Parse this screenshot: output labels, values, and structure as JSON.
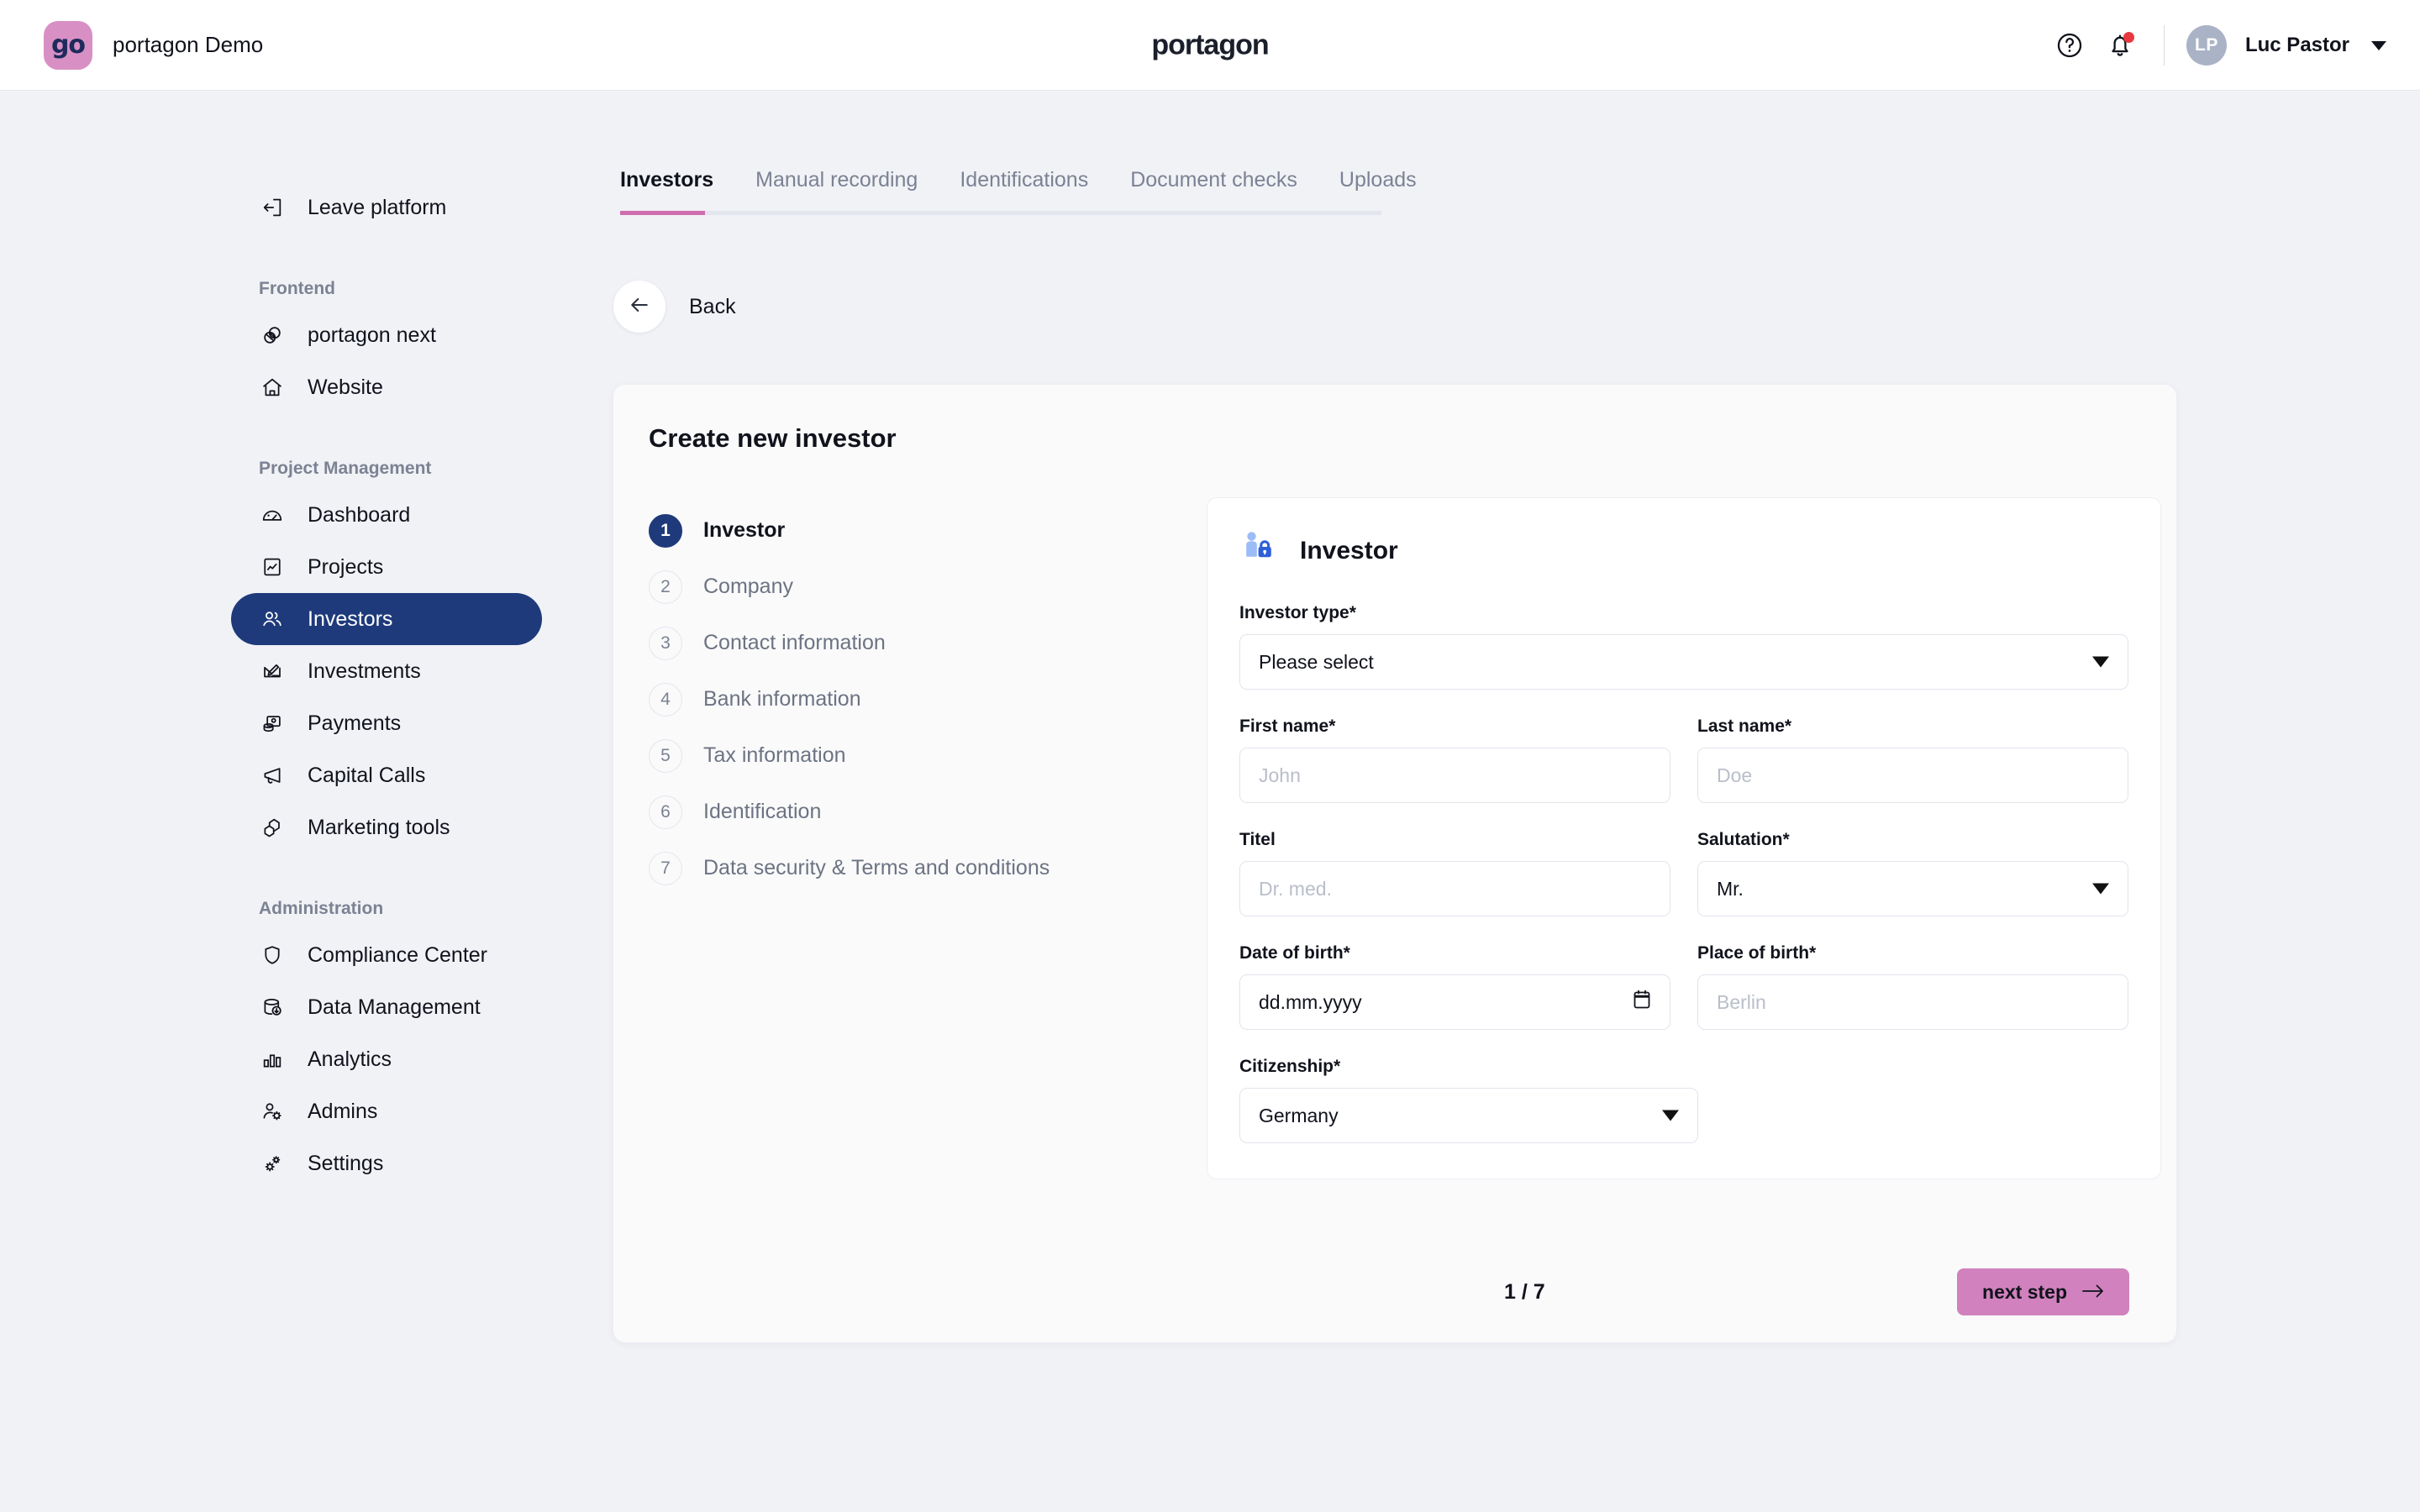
{
  "header": {
    "org_badge": "go",
    "org_name": "portagon Demo",
    "product_logo": "portagon",
    "help_icon": "help-circle-icon",
    "notifications_icon": "bell-icon",
    "avatar_initials": "LP",
    "user_name": "Luc Pastor",
    "user_menu_icon": "chevron-down-icon"
  },
  "sidebar": {
    "leave": {
      "label": "Leave platform",
      "icon": "logout-icon"
    },
    "groups": [
      {
        "title": "Frontend",
        "items": [
          {
            "label": "portagon next",
            "icon": "layers-icon",
            "active": false
          },
          {
            "label": "Website",
            "icon": "home-icon",
            "active": false
          }
        ]
      },
      {
        "title": "Project Management",
        "items": [
          {
            "label": "Dashboard",
            "icon": "gauge-icon",
            "active": false
          },
          {
            "label": "Projects",
            "icon": "chart-document-icon",
            "active": false
          },
          {
            "label": "Investors",
            "icon": "users-icon",
            "active": true
          },
          {
            "label": "Investments",
            "icon": "signature-icon",
            "active": false
          },
          {
            "label": "Payments",
            "icon": "coins-icon",
            "active": false
          },
          {
            "label": "Capital Calls",
            "icon": "megaphone-icon",
            "active": false
          },
          {
            "label": "Marketing tools",
            "icon": "boxes-icon",
            "active": false
          }
        ]
      },
      {
        "title": "Administration",
        "items": [
          {
            "label": "Compliance Center",
            "icon": "shield-icon",
            "active": false
          },
          {
            "label": "Data Management",
            "icon": "database-download-icon",
            "active": false
          },
          {
            "label": "Analytics",
            "icon": "bar-chart-icon",
            "active": false
          },
          {
            "label": "Admins",
            "icon": "user-gear-icon",
            "active": false
          },
          {
            "label": "Settings",
            "icon": "gears-icon",
            "active": false
          }
        ]
      }
    ]
  },
  "tabs": [
    {
      "label": "Investors",
      "active": true
    },
    {
      "label": "Manual recording",
      "active": false
    },
    {
      "label": "Identifications",
      "active": false
    },
    {
      "label": "Document checks",
      "active": false
    },
    {
      "label": "Uploads",
      "active": false
    }
  ],
  "back": {
    "label": "Back",
    "icon": "arrow-left-icon"
  },
  "card": {
    "title": "Create new investor",
    "steps": [
      {
        "num": "1",
        "label": "Investor",
        "active": true
      },
      {
        "num": "2",
        "label": "Company",
        "active": false
      },
      {
        "num": "3",
        "label": "Contact information",
        "active": false
      },
      {
        "num": "4",
        "label": "Bank information",
        "active": false
      },
      {
        "num": "5",
        "label": "Tax information",
        "active": false
      },
      {
        "num": "6",
        "label": "Identification",
        "active": false
      },
      {
        "num": "7",
        "label": "Data security & Terms and conditions",
        "active": false
      }
    ],
    "panel": {
      "icon": "person-lock-icon",
      "title": "Investor",
      "fields": {
        "investor_type": {
          "label": "Investor type*",
          "value": "Please select",
          "type": "select"
        },
        "first_name": {
          "label": "First name*",
          "placeholder": "John",
          "value": "",
          "type": "text"
        },
        "last_name": {
          "label": "Last name*",
          "placeholder": "Doe",
          "value": "",
          "type": "text"
        },
        "titel": {
          "label": "Titel",
          "placeholder": "Dr. med.",
          "value": "",
          "type": "text"
        },
        "salutation": {
          "label": "Salutation*",
          "value": "Mr.",
          "type": "select"
        },
        "date_of_birth": {
          "label": "Date of birth*",
          "value": "dd.mm.yyyy",
          "type": "date"
        },
        "place_of_birth": {
          "label": "Place of birth*",
          "placeholder": "Berlin",
          "value": "",
          "type": "text"
        },
        "citizenship": {
          "label": "Citizenship*",
          "value": "Germany",
          "type": "select"
        }
      }
    },
    "footer": {
      "page_count": "1 / 7",
      "next_label": "next step",
      "next_icon": "arrow-right-icon"
    }
  },
  "colors": {
    "page_bg": "#f1f2f6",
    "accent_pink": "#d06cb0",
    "accent_navy": "#1e3a7b",
    "badge_pink": "#d890c4",
    "notification_red": "#e8383d"
  }
}
